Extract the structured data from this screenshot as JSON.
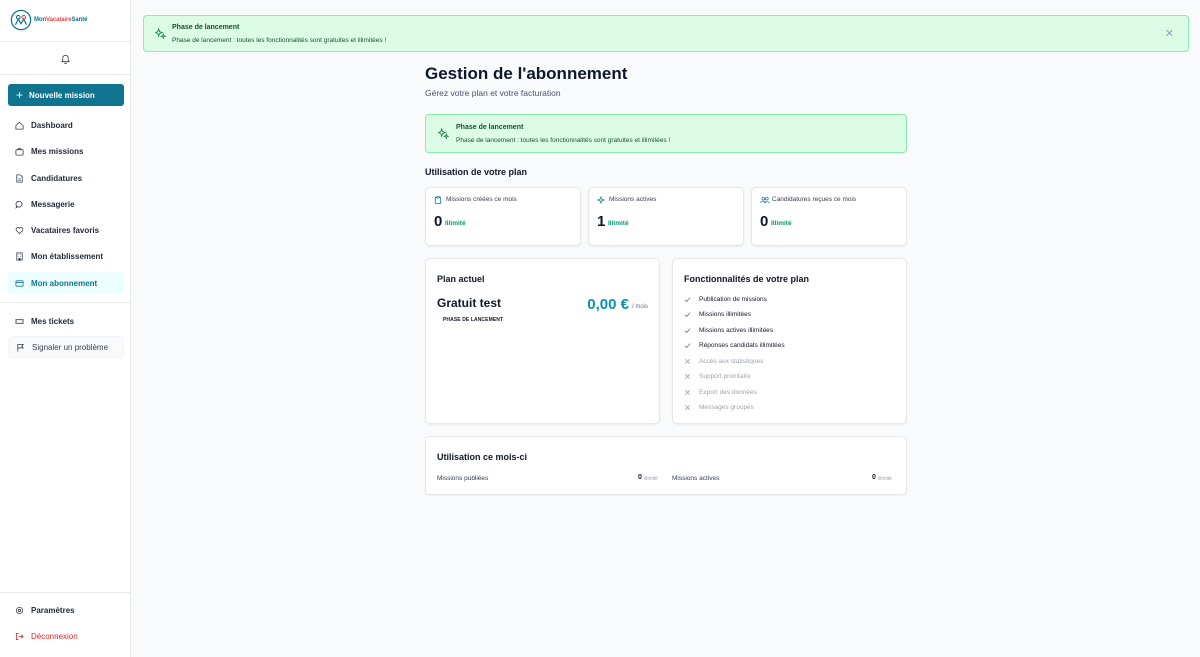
{
  "brand": {
    "part1": "Mon",
    "part2": "Vacataire",
    "part3": "Santé"
  },
  "sidebar": {
    "new_mission": "Nouvelle mission",
    "items": [
      {
        "label": "Dashboard",
        "icon": "home-icon"
      },
      {
        "label": "Mes missions",
        "icon": "briefcase-icon"
      },
      {
        "label": "Candidatures",
        "icon": "file-icon"
      },
      {
        "label": "Messagerie",
        "icon": "chat-icon"
      },
      {
        "label": "Vacataires favoris",
        "icon": "heart-icon"
      },
      {
        "label": "Mon établissement",
        "icon": "building-icon"
      },
      {
        "label": "Mon abonnement",
        "icon": "credit-card-icon",
        "active": true
      },
      {
        "label": "Mes tickets",
        "icon": "ticket-icon"
      },
      {
        "label": "Signaler un problème",
        "icon": "flag-icon"
      }
    ],
    "settings": "Paramètres",
    "logout": "Déconnexion"
  },
  "top_banner": {
    "title": "Phase de lancement",
    "text": "Phase de lancement : toutes les fonctionnalités sont gratuites et illimitées !"
  },
  "page": {
    "title": "Gestion de l'abonnement",
    "subtitle": "Gérez votre plan et votre facturation"
  },
  "inner_banner": {
    "title": "Phase de lancement",
    "text": "Phase de lancement : toutes les fonctionnalités sont gratuites et illimitées !"
  },
  "usage_plan": {
    "title": "Utilisation de votre plan",
    "stats": [
      {
        "label": "Missions créées ce mois",
        "value": "0",
        "unit": "Illimité",
        "icon": "clipboard-icon"
      },
      {
        "label": "Missions actives",
        "value": "1",
        "unit": "Illimité",
        "icon": "sparkle-icon"
      },
      {
        "label": "Candidatures reçues ce mois",
        "value": "0",
        "unit": "Illimité",
        "icon": "users-icon"
      }
    ]
  },
  "current_plan": {
    "title": "Plan actuel",
    "name": "Gratuit test",
    "price": "0,00 €",
    "period": "/ mois",
    "badge": "PHASE DE LANCEMENT"
  },
  "features": {
    "title": "Fonctionnalités de votre plan",
    "items": [
      {
        "label": "Publication de missions",
        "included": true
      },
      {
        "label": "Missions illimitées",
        "included": true
      },
      {
        "label": "Missions actives illimitées",
        "included": true
      },
      {
        "label": "Réponses candidats illimitées",
        "included": true
      },
      {
        "label": "Accès aux statistiques",
        "included": false
      },
      {
        "label": "Support prioritaire",
        "included": false
      },
      {
        "label": "Export des données",
        "included": false
      },
      {
        "label": "Messages groupés",
        "included": false
      }
    ]
  },
  "monthly_usage": {
    "title": "Utilisation ce mois-ci",
    "rows": [
      {
        "label": "Missions publiées",
        "value": "0",
        "unit": "illimité"
      },
      {
        "label": "Missions actives",
        "value": "0",
        "unit": "illimité"
      }
    ]
  },
  "colors": {
    "accent": "#0e7490",
    "success": "#059669",
    "banner_bg": "#dcfce7",
    "danger": "#dc2626"
  }
}
